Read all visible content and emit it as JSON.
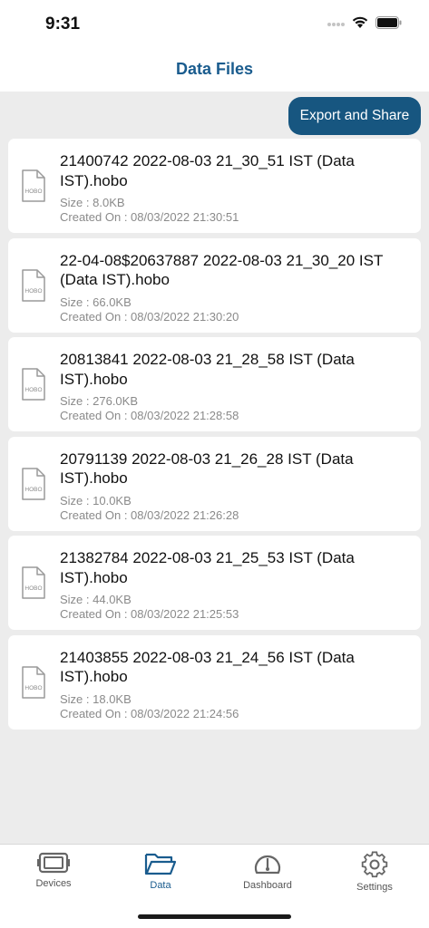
{
  "status": {
    "time": "9:31"
  },
  "nav": {
    "title": "Data Files"
  },
  "actions": {
    "export_label": "Export and Share"
  },
  "files": [
    {
      "name": "21400742 2022-08-03 21_30_51 IST (Data IST).hobo",
      "size": "Size : 8.0KB",
      "created": "Created On : 08/03/2022 21:30:51",
      "icon_text": "HOBO"
    },
    {
      "name": "22-04-08$20637887 2022-08-03 21_30_20 IST (Data IST).hobo",
      "size": "Size : 66.0KB",
      "created": "Created On : 08/03/2022 21:30:20",
      "icon_text": "HOBO"
    },
    {
      "name": "20813841 2022-08-03 21_28_58 IST (Data IST).hobo",
      "size": "Size : 276.0KB",
      "created": "Created On : 08/03/2022 21:28:58",
      "icon_text": "HOBO"
    },
    {
      "name": "20791139 2022-08-03 21_26_28 IST (Data IST).hobo",
      "size": "Size : 10.0KB",
      "created": "Created On : 08/03/2022 21:26:28",
      "icon_text": "HOBO"
    },
    {
      "name": "21382784 2022-08-03 21_25_53 IST (Data IST).hobo",
      "size": "Size : 44.0KB",
      "created": "Created On : 08/03/2022 21:25:53",
      "icon_text": "HOBO"
    },
    {
      "name": "21403855 2022-08-03 21_24_56 IST (Data IST).hobo",
      "size": "Size : 18.0KB",
      "created": "Created On : 08/03/2022 21:24:56",
      "icon_text": "HOBO"
    }
  ],
  "tabs": [
    {
      "label": "Devices",
      "icon": "devices-icon",
      "active": false
    },
    {
      "label": "Data",
      "icon": "folder-icon",
      "active": true
    },
    {
      "label": "Dashboard",
      "icon": "gauge-icon",
      "active": false
    },
    {
      "label": "Settings",
      "icon": "gear-icon",
      "active": false
    }
  ],
  "colors": {
    "accent": "#1a5c8e",
    "button_bg": "#175680",
    "background": "#ececec",
    "card": "#ffffff",
    "muted_text": "#8a8a8a"
  }
}
